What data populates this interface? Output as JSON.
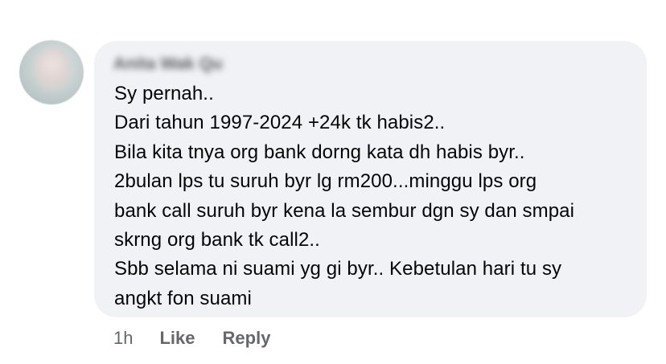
{
  "comment": {
    "author": "Anita Wak Qu",
    "lines": [
      "Sy pernah..",
      "Dari tahun 1997-2024 +24k tk habis2..",
      "Bila kita tnya org bank dorng kata dh habis byr..",
      "2bulan lps tu suruh byr lg rm200...minggu lps org",
      "bank call suruh byr kena la sembur dgn sy dan smpai",
      "skrng org bank tk call2..",
      "Sbb selama ni suami yg gi byr.. Kebetulan hari tu sy",
      "angkt fon suami"
    ],
    "timestamp": "1h",
    "like_label": "Like",
    "reply_label": "Reply"
  }
}
